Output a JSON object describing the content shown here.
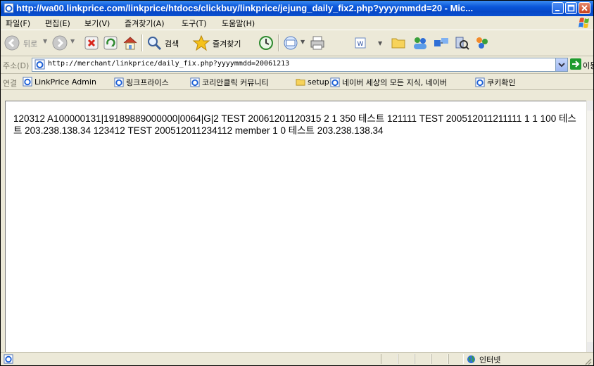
{
  "window": {
    "title": "http://wa00.linkprice.com/linkprice/htdocs/clickbuy/linkprice/jejung_daily_fix2.php?yyyymmdd=20 - Mic...",
    "minimize_icon": "minimize-icon",
    "maximize_icon": "maximize-icon",
    "close_icon": "close-icon",
    "title_bar_color": "#0a55d9"
  },
  "menu": {
    "items": [
      "파일(F)",
      "편집(E)",
      "보기(V)",
      "즐겨찾기(A)",
      "도구(T)",
      "도움말(H)"
    ]
  },
  "toolbar": {
    "back_label": "뒤로",
    "search_label": "검색",
    "favorites_label": "즐겨찾기",
    "icons": [
      "back-icon",
      "forward-icon",
      "stop-icon",
      "refresh-icon",
      "home-icon",
      "search-icon",
      "favorites-star-icon",
      "history-icon",
      "mail-icon",
      "print-icon",
      "word-icon",
      "folder-icon",
      "messenger-icon",
      "bluetooth-icon",
      "research-icon",
      "users-icon"
    ]
  },
  "address": {
    "label": "주소(D)",
    "url": "http://merchant/linkprice/daily_fix.php?yyyymmdd=20061213",
    "go_label": "이동"
  },
  "links": {
    "label": "연결",
    "items": [
      "LinkPrice Admin",
      "링크프라이스",
      "코리안클릭 커뮤니티",
      "setup",
      "네이버  세상의 모든 지식, 네이버",
      "쿠키확인"
    ]
  },
  "content": {
    "text": "120312 A100000131|19189889000000|0064|G|2 TEST 20061201120315 2 1 350 테스트 121111 TEST 200512011211111 1 1 100 테스트 203.238.138.34 123412 TEST 200512011234112 member 1 0 테스트 203.238.138.34"
  },
  "status": {
    "zone": "인터넷"
  }
}
